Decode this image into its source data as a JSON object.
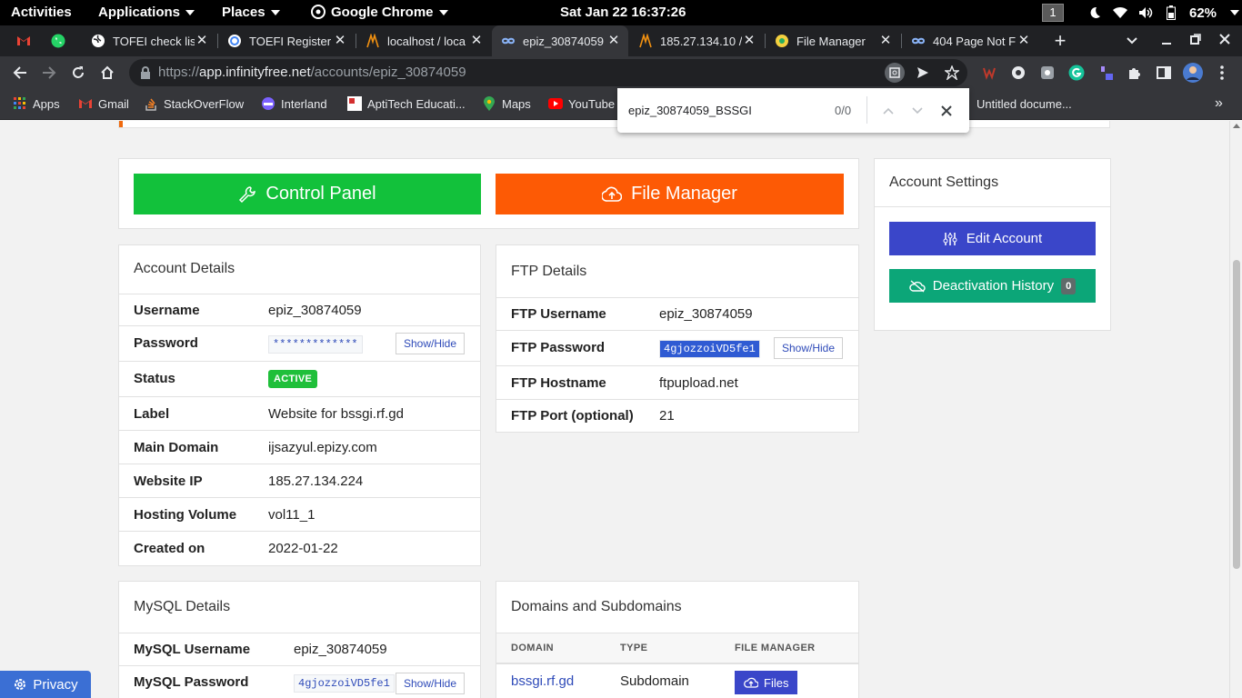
{
  "gnome": {
    "activities": "Activities",
    "applications": "Applications",
    "places": "Places",
    "browser_app": "Google Chrome",
    "clock": "Sat Jan 22  16:37:26",
    "workspace": "1",
    "battery": "62%"
  },
  "tabs": [
    {
      "title": "",
      "icon": "gmail-icon"
    },
    {
      "title": "",
      "icon": "whatsapp-icon"
    },
    {
      "title": "TOFEI check list",
      "icon": "globe-icon"
    },
    {
      "title": "TOEFI Register",
      "icon": "google-form-icon"
    },
    {
      "title": "localhost / loca",
      "icon": "phpmyadmin-icon"
    },
    {
      "title": "epiz_30874059",
      "icon": "infinityfree-icon",
      "active": true
    },
    {
      "title": "185.27.134.10 /",
      "icon": "phpmyadmin-icon"
    },
    {
      "title": "File Manager",
      "icon": "filemanager-icon"
    },
    {
      "title": "404 Page Not F",
      "icon": "infinityfree-icon"
    }
  ],
  "omnibox": {
    "scheme": "https://",
    "host": "app.infinityfree.net",
    "path": "/accounts/epiz_30874059"
  },
  "bookmarks": [
    {
      "label": "Apps",
      "icon": "apps-grid-icon"
    },
    {
      "label": "Gmail",
      "icon": "gmail-icon"
    },
    {
      "label": "StackOverFlow",
      "icon": "stackoverflow-icon"
    },
    {
      "label": "Interland",
      "icon": "interland-icon"
    },
    {
      "label": "AptiTech Educati...",
      "icon": "aptitech-icon"
    },
    {
      "label": "Maps",
      "icon": "maps-icon"
    },
    {
      "label": "YouTube",
      "icon": "youtube-icon"
    },
    {
      "label": "Untitled docume...",
      "icon": "docs-icon"
    }
  ],
  "find": {
    "query": "epiz_30874059_BSSGI",
    "count": "0/0"
  },
  "buttons": {
    "control_panel": "Control Panel",
    "file_manager": "File Manager"
  },
  "account_settings": {
    "title": "Account Settings",
    "edit": "Edit Account",
    "deactivation": "Deactivation History",
    "deactivation_count": "0"
  },
  "account_details": {
    "title": "Account Details",
    "rows": [
      {
        "key": "Username",
        "value": "epiz_30874059"
      },
      {
        "key": "Password",
        "value": "*************"
      },
      {
        "key": "Status",
        "value": "ACTIVE"
      },
      {
        "key": "Label",
        "value": "Website for bssgi.rf.gd"
      },
      {
        "key": "Main Domain",
        "value": "ijsazyul.epizy.com"
      },
      {
        "key": "Website IP",
        "value": "185.27.134.224"
      },
      {
        "key": "Hosting Volume",
        "value": "vol11_1"
      },
      {
        "key": "Created on",
        "value": "2022-01-22"
      }
    ],
    "show_hide": "Show/Hide"
  },
  "ftp_details": {
    "title": "FTP Details",
    "rows": [
      {
        "key": "FTP Username",
        "value": "epiz_30874059"
      },
      {
        "key": "FTP Password",
        "value": "4gjozzoiVD5fe1"
      },
      {
        "key": "FTP Hostname",
        "value": "ftpupload.net"
      },
      {
        "key": "FTP Port (optional)",
        "value": "21"
      }
    ],
    "show_hide": "Show/Hide"
  },
  "mysql_details": {
    "title": "MySQL Details",
    "rows": [
      {
        "key": "MySQL Username",
        "value": "epiz_30874059"
      },
      {
        "key": "MySQL Password",
        "value": "4gjozzoiVD5fe1"
      }
    ],
    "show_hide": "Show/Hide"
  },
  "domains": {
    "title": "Domains and Subdomains",
    "columns": [
      "DOMAIN",
      "TYPE",
      "FILE MANAGER"
    ],
    "rows": [
      {
        "domain": "bssgi.rf.gd",
        "type": "Subdomain",
        "action": "Files"
      }
    ]
  },
  "privacy": "Privacy",
  "colors": {
    "control_panel": "#12c13b",
    "file_manager": "#fd5a05",
    "edit_account": "#3a46c9",
    "deactivation": "#0ca678",
    "link": "#2f4bb9"
  }
}
